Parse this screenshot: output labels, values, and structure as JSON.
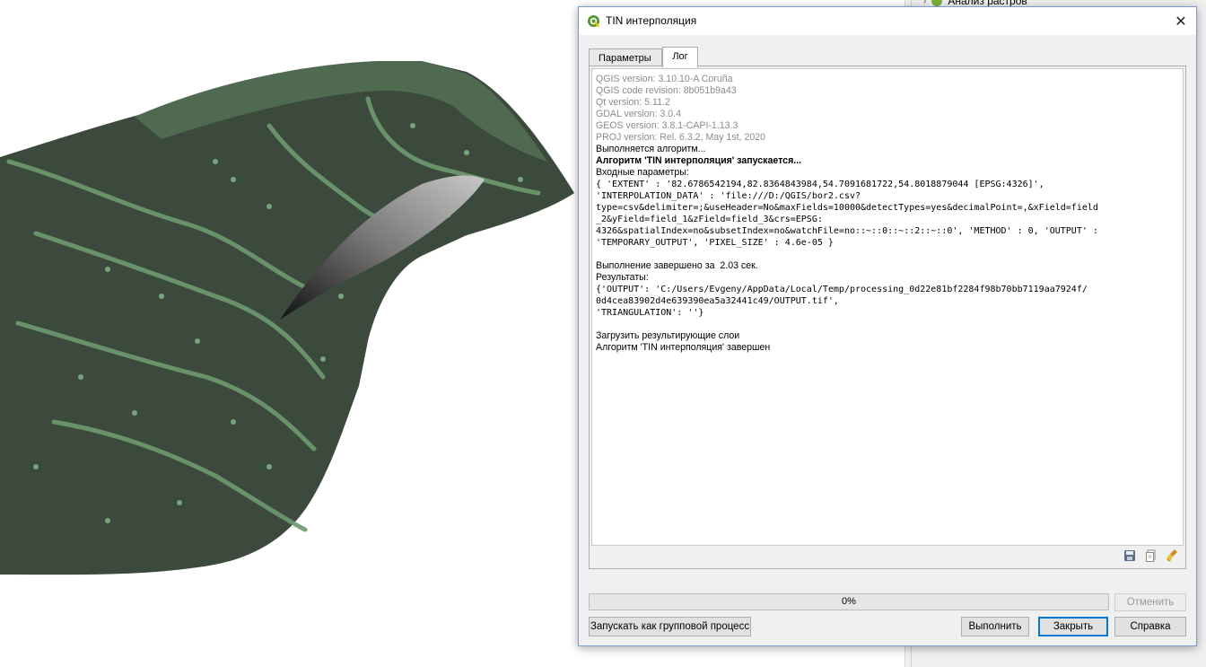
{
  "background": {
    "tree_item_label": "Анализ растров"
  },
  "dialog": {
    "title": "TIN интерполяция",
    "close_symbol": "✕",
    "tabs": [
      {
        "label": "Параметры",
        "active": false
      },
      {
        "label": "Лог",
        "active": true
      }
    ],
    "log": {
      "lines": [
        {
          "text": "QGIS version: 3.10.10-A Coruña",
          "style": "gray"
        },
        {
          "text": "QGIS code revision: 8b051b9a43",
          "style": "gray"
        },
        {
          "text": "Qt version: 5.11.2",
          "style": "gray"
        },
        {
          "text": "GDAL version: 3.0.4",
          "style": "gray"
        },
        {
          "text": "GEOS version: 3.8.1-CAPI-1.13.3",
          "style": "gray"
        },
        {
          "text": "PROJ version: Rel. 6.3.2, May 1st, 2020",
          "style": "gray"
        },
        {
          "text": "Выполняется алгоритм...",
          "style": "normal"
        },
        {
          "text": "Алгоритм 'TIN интерполяция' запускается...",
          "style": "bold"
        },
        {
          "text": "Входные параметры:",
          "style": "normal"
        },
        {
          "text": "{ 'EXTENT' : '82.6786542194,82.8364843984,54.7091681722,54.8018879044 [EPSG:4326]',",
          "style": "mono"
        },
        {
          "text": "'INTERPOLATION_DATA' : 'file:///D:/QGIS/bor2.csv?",
          "style": "mono"
        },
        {
          "text": "type=csv&delimiter=;&useHeader=No&maxFields=10000&detectTypes=yes&decimalPoint=,&xField=field",
          "style": "mono"
        },
        {
          "text": "_2&yField=field_1&zField=field_3&crs=EPSG:",
          "style": "mono"
        },
        {
          "text": "4326&spatialIndex=no&subsetIndex=no&watchFile=no::~::0::~::2::~::0', 'METHOD' : 0, 'OUTPUT' :",
          "style": "mono"
        },
        {
          "text": "'TEMPORARY_OUTPUT', 'PIXEL_SIZE' : 4.6e-05 }",
          "style": "mono"
        },
        {
          "text": "",
          "style": "blank"
        },
        {
          "text": "Выполнение завершено за  2.03 сек.",
          "style": "normal"
        },
        {
          "text": "Результаты:",
          "style": "normal"
        },
        {
          "text": "{'OUTPUT': 'C:/Users/Evgeny/AppData/Local/Temp/processing_0d22e81bf2284f98b70bb7119aa7924f/",
          "style": "mono"
        },
        {
          "text": "0d4cea83902d4e639390ea5a32441c49/OUTPUT.tif',",
          "style": "mono"
        },
        {
          "text": "'TRIANGULATION': ''}",
          "style": "mono"
        },
        {
          "text": "",
          "style": "blank"
        },
        {
          "text": "Загрузить результирующие слои",
          "style": "normal"
        },
        {
          "text": "Алгоритм 'TIN интерполяция' завершен",
          "style": "normal"
        }
      ]
    },
    "progress": {
      "value": 0,
      "label": "0%"
    },
    "buttons": {
      "cancel": "Отменить",
      "batch": "Запускать как групповой процесс",
      "run": "Выполнить",
      "close": "Закрыть",
      "help": "Справка"
    }
  }
}
